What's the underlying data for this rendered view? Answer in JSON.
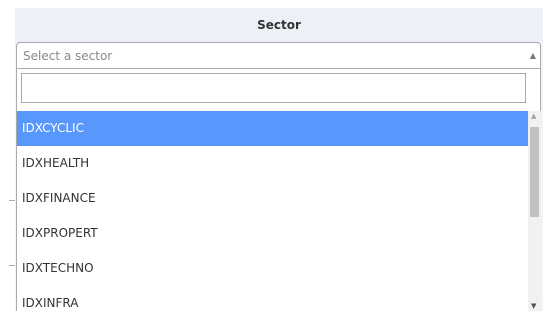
{
  "header": {
    "title": "Sector"
  },
  "select": {
    "placeholder": "Select a sector"
  },
  "search": {
    "value": ""
  },
  "options": [
    "IDXCYCLIC",
    "IDXHEALTH",
    "IDXFINANCE",
    "IDXPROPERT",
    "IDXTECHNO",
    "IDXINFRA"
  ],
  "highlighted_option": "IDXCYCLIC",
  "colors": {
    "highlight": "#5897fb",
    "header_bg": "#eef0f8"
  }
}
